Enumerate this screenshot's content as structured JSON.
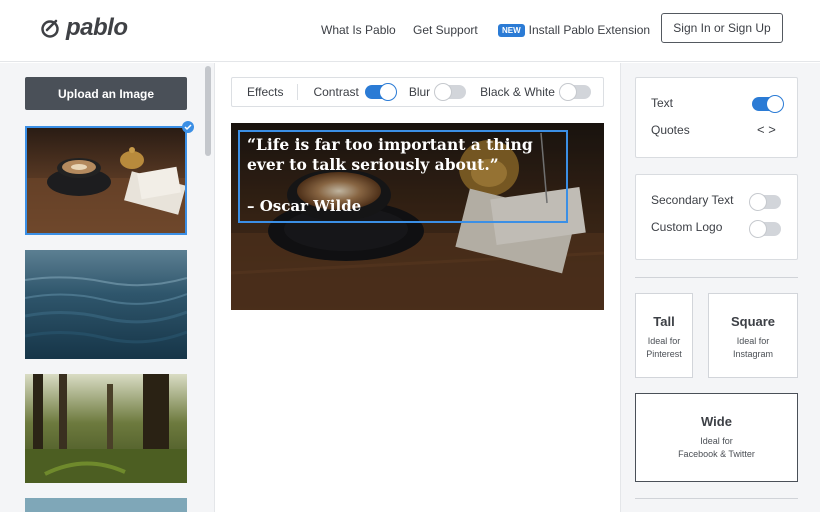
{
  "header": {
    "logo_text": "pablo",
    "nav": {
      "what_is": "What Is Pablo",
      "support": "Get Support",
      "new_badge": "NEW",
      "install": "Install Pablo Extension"
    },
    "signin_label": "Sign In or Sign Up"
  },
  "left_panel": {
    "upload_label": "Upload an Image",
    "images": [
      {
        "name": "coffee-cup-image",
        "selected": true
      },
      {
        "name": "ocean-water-image",
        "selected": false
      },
      {
        "name": "forest-image",
        "selected": false
      },
      {
        "name": "sky-image",
        "selected": false
      }
    ]
  },
  "toolbar": {
    "effects_label": "Effects",
    "contrast_label": "Contrast",
    "contrast_on": true,
    "blur_label": "Blur",
    "blur_on": false,
    "bw_label": "Black & White",
    "bw_on": false
  },
  "canvas": {
    "quote": "“Life is far too important a thing ever to talk seriously about.”",
    "author": "– Oscar Wilde"
  },
  "right_panel": {
    "text_label": "Text",
    "text_on": true,
    "quotes_label": "Quotes",
    "quotes_arrows": "< >",
    "secondary_label": "Secondary Text",
    "secondary_on": false,
    "logo_label": "Custom Logo",
    "logo_on": false,
    "sizes": {
      "tall_title": "Tall",
      "tall_sub_1": "Ideal for",
      "tall_sub_2": "Pinterest",
      "square_title": "Square",
      "square_sub_1": "Ideal for",
      "square_sub_2": "Instagram",
      "wide_title": "Wide",
      "wide_sub_1": "Ideal for",
      "wide_sub_2": "Facebook & Twitter"
    }
  },
  "colors": {
    "accent": "#2b7bd5",
    "dark_button": "#4a5058",
    "panel_bg": "#f4f5f7"
  }
}
